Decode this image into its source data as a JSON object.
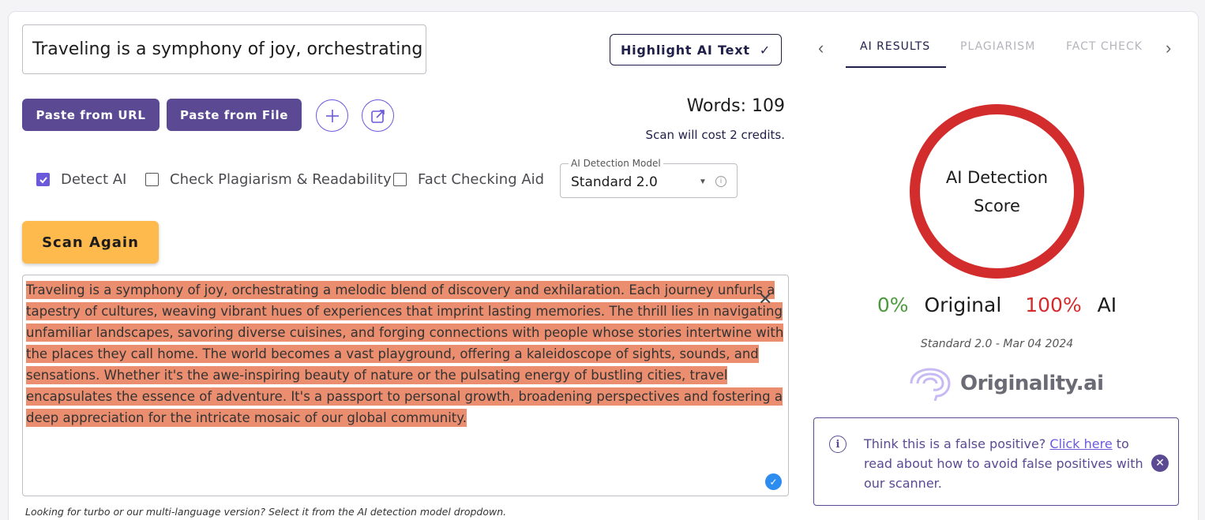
{
  "title_input": {
    "value": "Traveling is a symphony of joy, orchestrating a melodic blend of discovery and exhilaration."
  },
  "toolbar": {
    "highlight_label": "Highlight AI Text",
    "paste_url_label": "Paste from URL",
    "paste_file_label": "Paste from File",
    "add_icon": "plus-icon",
    "share_icon": "share-icon",
    "words_text": "Words: 109",
    "credits_text": "Scan will cost 2 credits."
  },
  "options": {
    "detect_ai": {
      "label": "Detect AI",
      "checked": true
    },
    "plagiarism": {
      "label": "Check Plagiarism & Readability",
      "checked": false
    },
    "fact_check": {
      "label": "Fact Checking Aid",
      "checked": false
    },
    "model_legend": "AI Detection Model",
    "model_value": "Standard 2.0"
  },
  "scan_label": "Scan Again",
  "content": {
    "text": "Traveling is a symphony of joy, orchestrating a melodic blend of discovery and exhilaration. Each journey unfurls a tapestry of cultures, weaving vibrant hues of experiences that imprint lasting memories. The thrill lies in navigating unfamiliar landscapes, savoring diverse cuisines, and forging connections with people whose stories intertwine with the places they call home. The world becomes a vast playground, offering a kaleidoscope of sights, sounds, and sensations. Whether it's the awe-inspiring beauty of nature or the pulsating energy of bustling cities, travel encapsulates the essence of adventure. It's a passport to personal growth, broadening perspectives and fostering a deep appreciation for the intricate mosaic of our global community.",
    "highlight_color": "#eb8e6f"
  },
  "hint_text": "Looking for turbo or our multi-language version? Select it from the AI detection model dropdown.",
  "results": {
    "tabs": [
      {
        "label": "AI RESULTS",
        "active": true
      },
      {
        "label": "PLAGIARISM",
        "active": false
      },
      {
        "label": "FACT CHECK",
        "active": false
      }
    ],
    "score_label": "AI Detection Score",
    "original_pct": "0%",
    "original_label": "Original",
    "ai_pct": "100%",
    "ai_label": "AI",
    "model_date": "Standard 2.0 - Mar 04 2024",
    "brand": "Originality.ai",
    "colors": {
      "ring": "#d32c2c",
      "original": "#4a9b3b",
      "ai": "#d32c2c",
      "accent": "#5b4a93"
    }
  },
  "false_positive": {
    "prefix": "Think this is a false positive?",
    "link": "Click here",
    "suffix": "to read about how to avoid false positives with our scanner."
  }
}
